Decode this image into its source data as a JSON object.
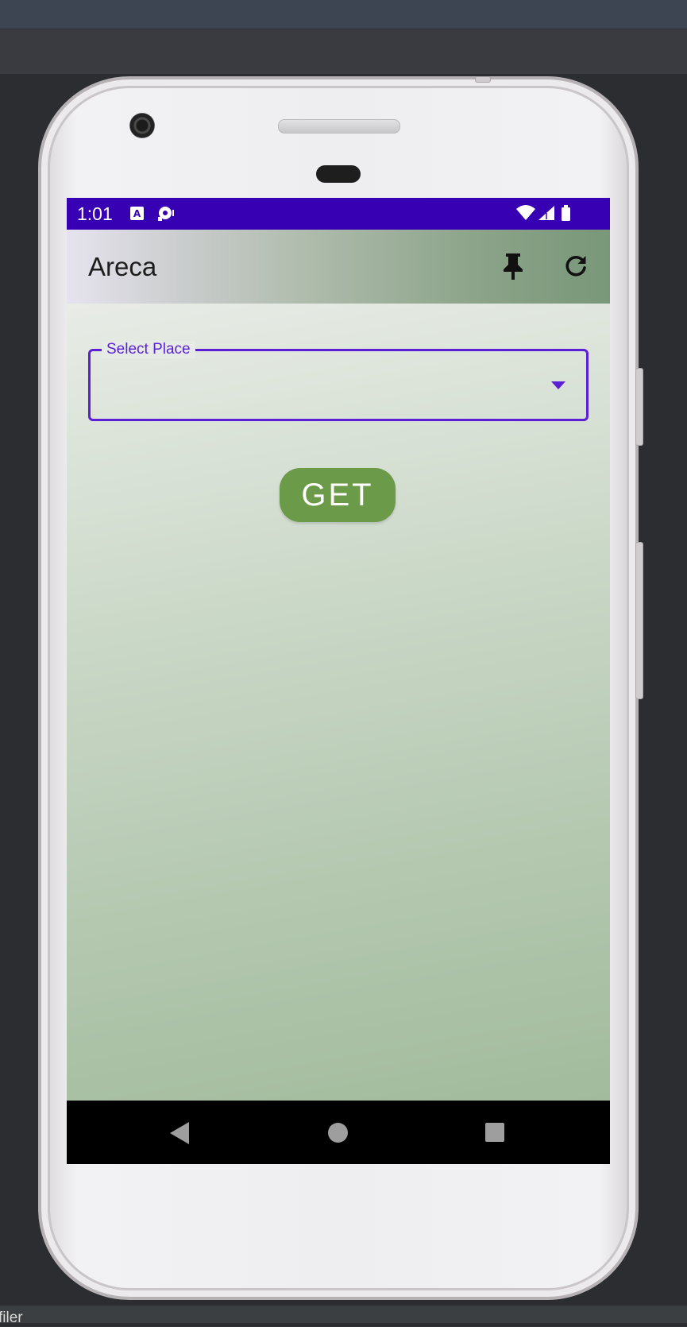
{
  "ide": {
    "bottom_label": "filer"
  },
  "status_bar": {
    "time": "1:01",
    "left_icons": [
      "text-a-icon",
      "media-record-icon"
    ],
    "right_icons": [
      "wifi-icon",
      "signal-icon",
      "battery-icon"
    ],
    "color": "#3700b3"
  },
  "app_bar": {
    "title": "Areca",
    "actions": [
      "pin-icon",
      "refresh-icon"
    ]
  },
  "form": {
    "select_label": "Select Place",
    "select_value": "",
    "get_button": "GET",
    "accent_color": "#5b1fd6",
    "button_color": "#6b9a48"
  },
  "nav_bar": {
    "items": [
      "back-icon",
      "home-icon",
      "recents-icon"
    ]
  }
}
